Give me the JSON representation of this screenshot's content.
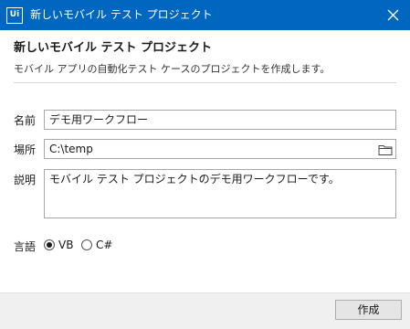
{
  "window": {
    "title": "新しいモバイル テスト プロジェクト",
    "app_icon_text": "Ui",
    "accent_color": "#0067c0"
  },
  "header": {
    "title": "新しいモバイル テスト プロジェクト",
    "description": "モバイル アプリの自動化テスト ケースのプロジェクトを作成します。"
  },
  "form": {
    "name_label": "名前",
    "name_value": "デモ用ワークフロー",
    "location_label": "場所",
    "location_value": "C:\\temp",
    "description_label": "説明",
    "description_value": "モバイル テスト プロジェクトのデモ用ワークフローです。",
    "language_label": "言語",
    "language_options": [
      "VB",
      "C#"
    ],
    "language_selected": "VB"
  },
  "footer": {
    "create_label": "作成"
  },
  "icons": {
    "close": "close-icon",
    "folder": "folder-icon",
    "app": "uipath-logo-icon"
  }
}
